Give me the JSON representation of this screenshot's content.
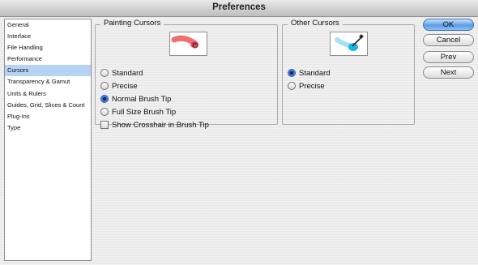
{
  "window": {
    "title": "Preferences"
  },
  "sidebar": {
    "items": [
      {
        "label": "General"
      },
      {
        "label": "Interface"
      },
      {
        "label": "File Handling"
      },
      {
        "label": "Performance"
      },
      {
        "label": "Cursors",
        "selected": true
      },
      {
        "label": "Transparency & Gamut"
      },
      {
        "label": "Units & Rulers"
      },
      {
        "label": "Guides, Grid, Slices & Count"
      },
      {
        "label": "Plug-Ins"
      },
      {
        "label": "Type"
      }
    ]
  },
  "painting_cursors": {
    "title": "Painting Cursors",
    "preview_icon": "brush-tip-preview-icon",
    "options": [
      {
        "label": "Standard",
        "checked": false
      },
      {
        "label": "Precise",
        "checked": false
      },
      {
        "label": "Normal Brush Tip",
        "checked": true
      },
      {
        "label": "Full Size Brush Tip",
        "checked": false
      }
    ],
    "crosshair": {
      "label": "Show Crosshair in Brush Tip",
      "checked": false
    }
  },
  "other_cursors": {
    "title": "Other Cursors",
    "preview_icon": "eyedropper-preview-icon",
    "options": [
      {
        "label": "Standard",
        "checked": true
      },
      {
        "label": "Precise",
        "checked": false
      }
    ]
  },
  "buttons": {
    "ok": "OK",
    "cancel": "Cancel",
    "prev": "Prev",
    "next": "Next"
  },
  "colors": {
    "selection": "#b6d3f4",
    "accent": "#5b9ce6",
    "brush_red": "#e0223a",
    "eyedropper_cyan": "#19b4e6"
  }
}
